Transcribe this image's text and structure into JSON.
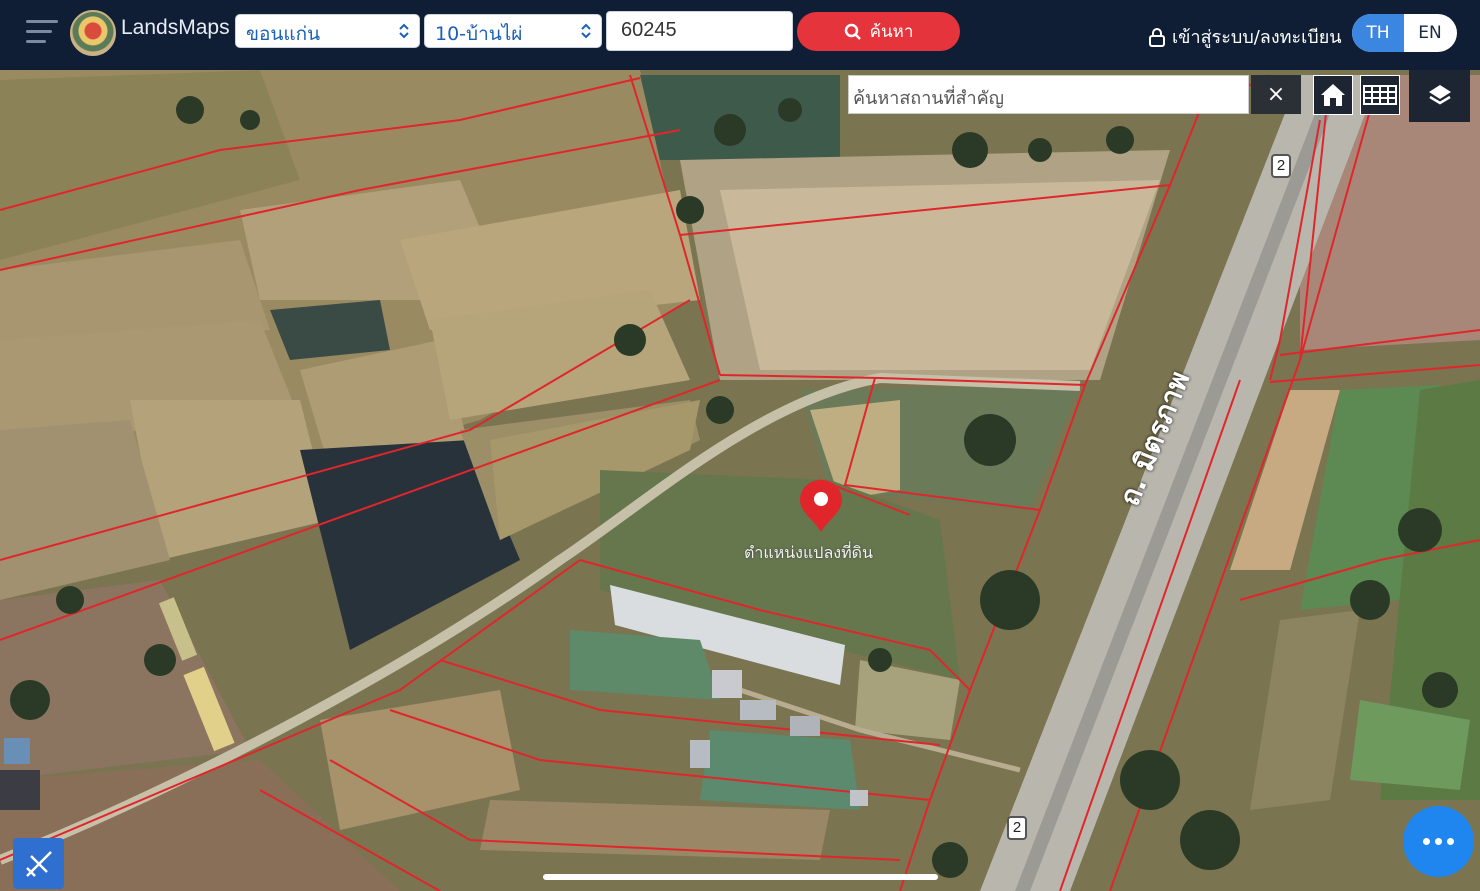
{
  "header": {
    "brand": "LandsMaps",
    "province": "ขอนแก่น",
    "district": "10-บ้านไผ่",
    "parcel_number": "60245",
    "search_label": "ค้นหา",
    "login_label": "เข้าสู่ระบบ/ลงทะเบียน",
    "lang_th": "TH",
    "lang_en": "EN"
  },
  "map": {
    "place_search_placeholder": "ค้นหาสถานที่สำคัญ",
    "clear_symbol": "×",
    "pin_label": "ตำแหน่งแปลงที่ดิน",
    "road_label": "ถ. มิตรภาพ",
    "route_shield": "2",
    "parcel_line_color": "#e0262b",
    "pin_color": "#e0262b"
  }
}
